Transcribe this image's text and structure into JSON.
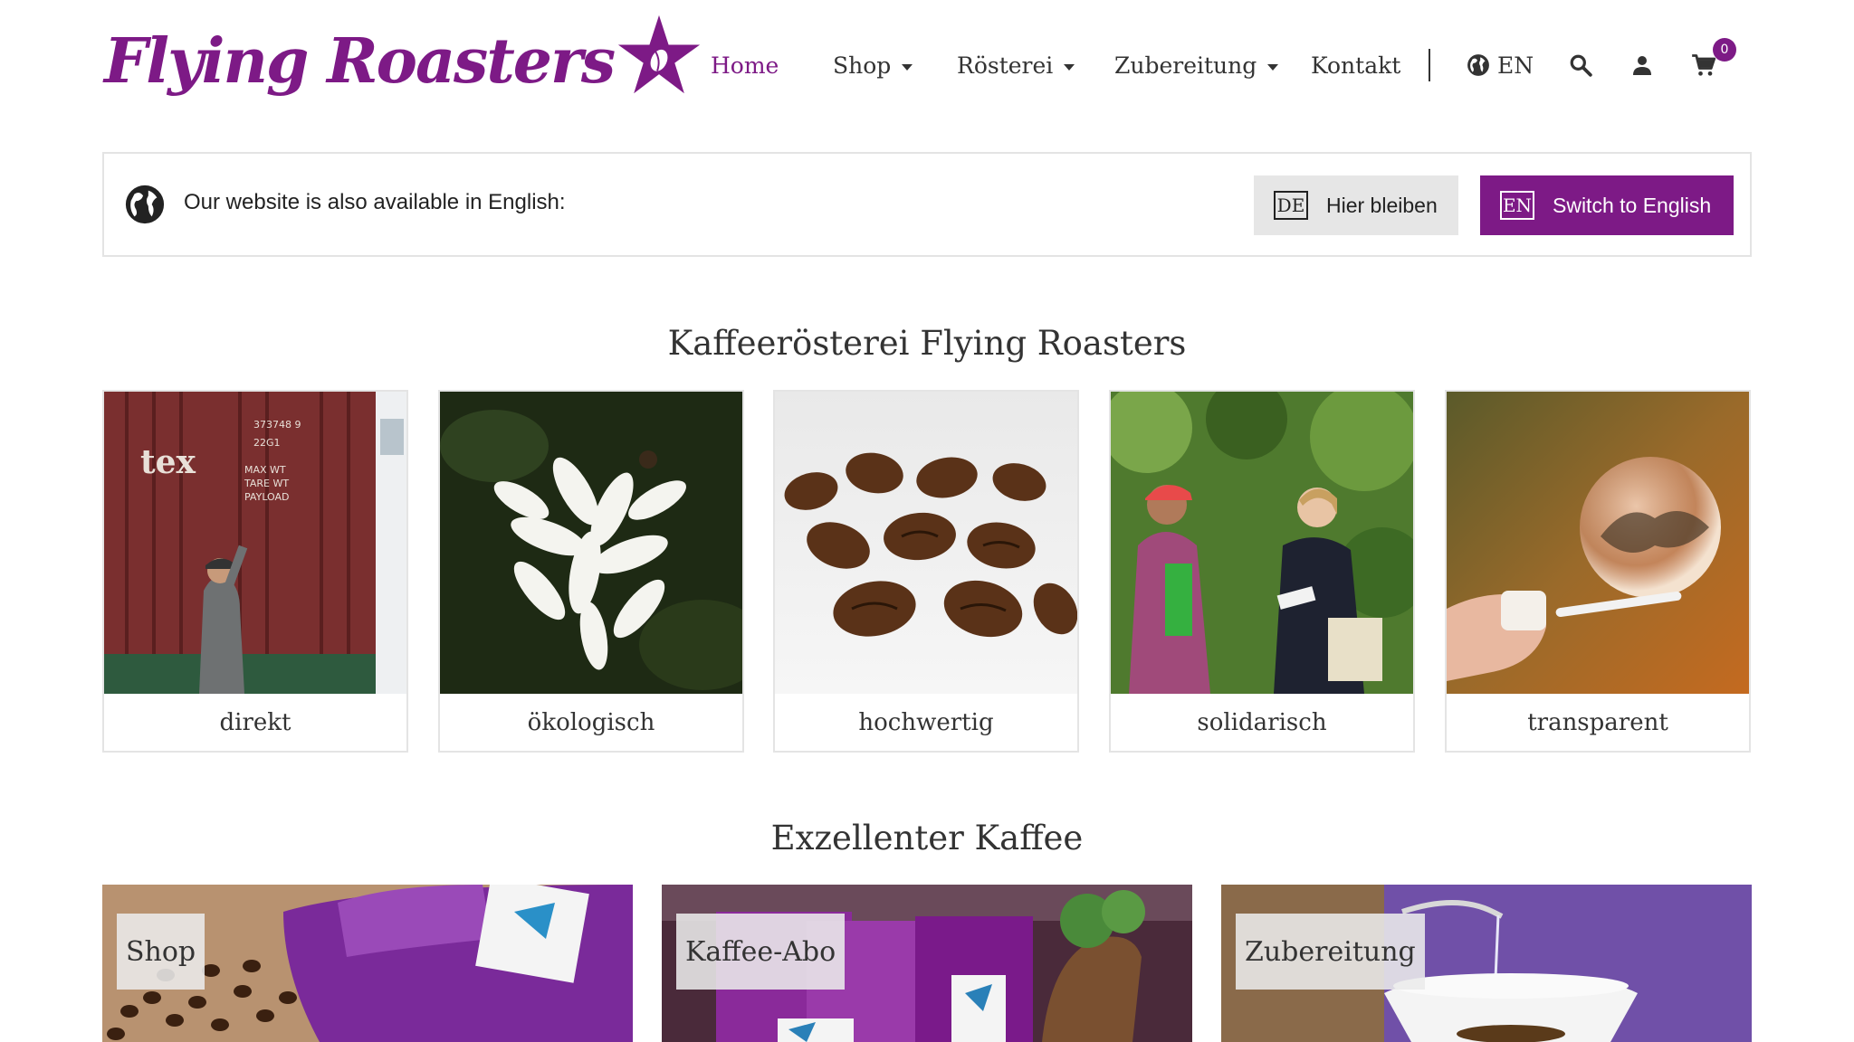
{
  "header": {
    "logo_text": "Flying Roasters",
    "nav": {
      "home": "Home",
      "shop": "Shop",
      "roesterei": "Rösterei",
      "zubereitung": "Zubereitung",
      "kontakt": "Kontakt",
      "language": "EN"
    },
    "cart_count": "0",
    "icons": [
      "globe-icon",
      "search-icon",
      "user-icon",
      "cart-icon"
    ]
  },
  "language_banner": {
    "message": "Our website is also available in English:",
    "stay_code": "DE",
    "stay_label": "Hier bleiben",
    "switch_code": "EN",
    "switch_label": "Switch to English"
  },
  "values_section": {
    "title": "Kaffeerösterei Flying Roasters",
    "cards": [
      {
        "label": "direkt"
      },
      {
        "label": "ökologisch"
      },
      {
        "label": "hochwertig"
      },
      {
        "label": "solidarisch"
      },
      {
        "label": "transparent"
      }
    ]
  },
  "features_section": {
    "title": "Exzellenter Kaffee",
    "tiles": [
      {
        "label": "Shop"
      },
      {
        "label": "Kaffee-Abo"
      },
      {
        "label": "Zubereitung"
      }
    ]
  },
  "colors": {
    "brand": "#7d1a86",
    "text": "#333333",
    "border": "#e4e4e4",
    "button_neutral": "#e6e6e6"
  }
}
